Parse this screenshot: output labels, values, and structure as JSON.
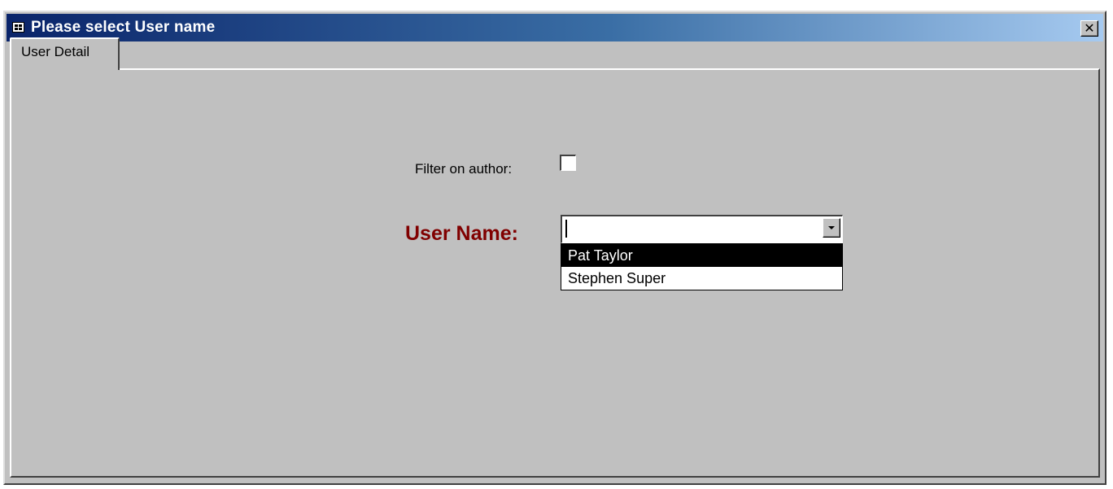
{
  "window": {
    "title": "Please select User name",
    "close_symbol": "✕",
    "title_icon": "form-icon"
  },
  "tabs": [
    {
      "label": "User Detail",
      "active": true
    }
  ],
  "form": {
    "filter_label": "Filter on author:",
    "filter_checked": false,
    "username_label": "User Name:",
    "username_value": "",
    "username_options": [
      "Pat Taylor",
      "Stephen Super"
    ],
    "highlighted_option": "Pat Taylor"
  },
  "colors": {
    "titlebar_start": "#0a246a",
    "titlebar_end": "#a6caf0",
    "window_bg": "#c0c0c0",
    "label_accent": "#800000",
    "highlight": "#000000"
  }
}
